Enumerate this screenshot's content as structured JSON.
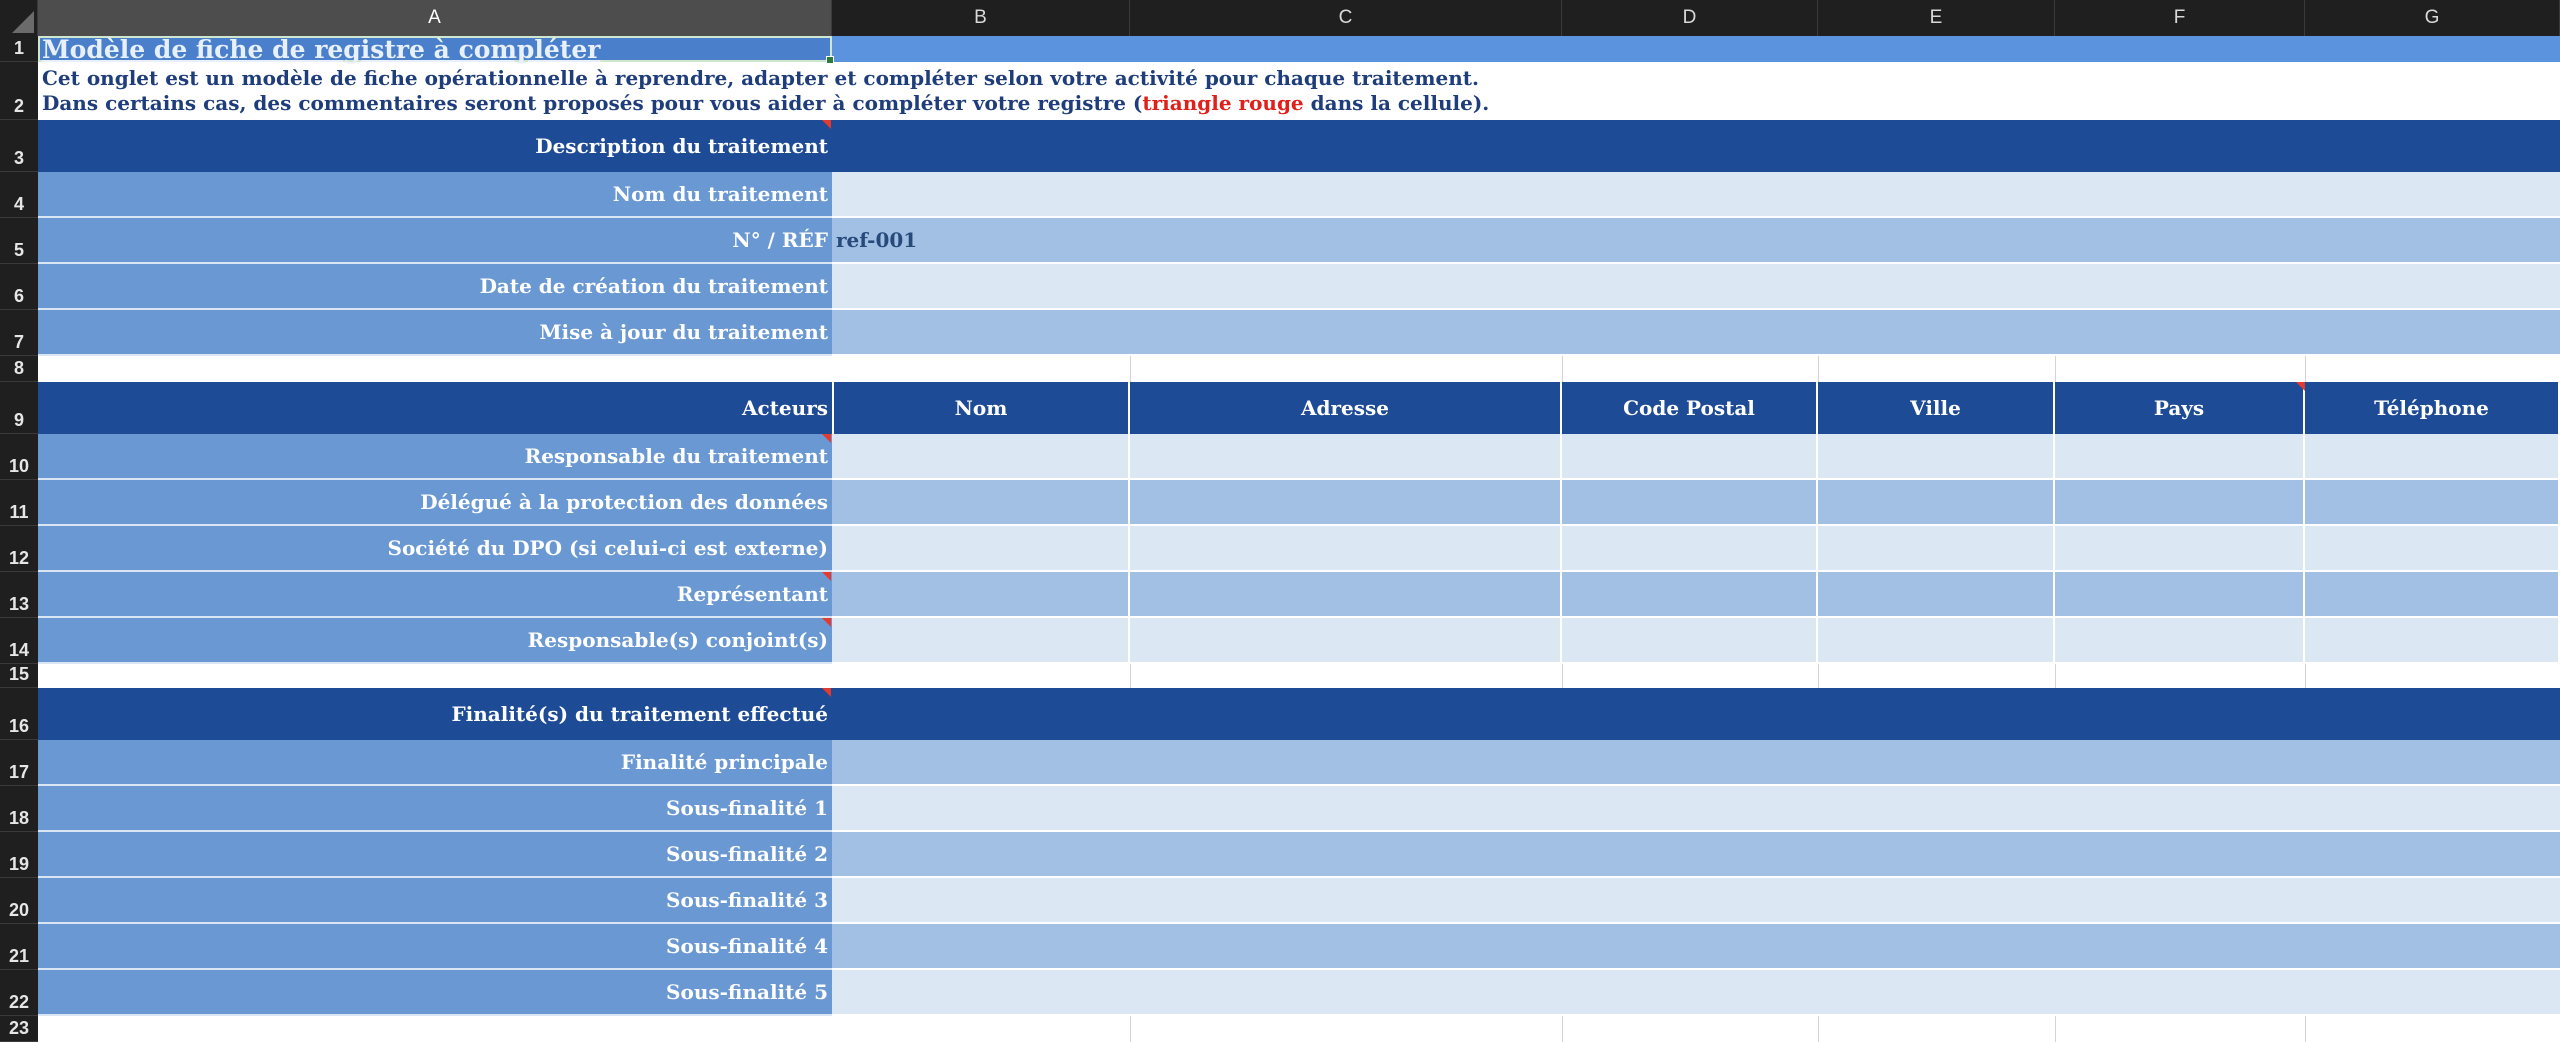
{
  "columns": [
    "A",
    "B",
    "C",
    "D",
    "E",
    "F",
    "G"
  ],
  "rows": [
    "1",
    "2",
    "3",
    "4",
    "5",
    "6",
    "7",
    "8",
    "9",
    "10",
    "11",
    "12",
    "13",
    "14",
    "15",
    "16",
    "17",
    "18",
    "19",
    "20",
    "21",
    "22",
    "23"
  ],
  "title": "Modèle de fiche de registre à compléter",
  "instructions": {
    "line1": "Cet onglet est un modèle de fiche opérationnelle à reprendre, adapter et compléter selon votre activité pour chaque traitement.",
    "line2_before": "Dans certains cas, des commentaires seront proposés pour vous aider à compléter votre registre (",
    "line2_red": "triangle rouge",
    "line2_after": " dans la cellule)."
  },
  "description": {
    "header": "Description  du traitement",
    "fields": [
      {
        "label": "Nom du traitement",
        "value": ""
      },
      {
        "label": "N° / RÉF",
        "value": "ref-001"
      },
      {
        "label": "Date de création du traitement",
        "value": ""
      },
      {
        "label": "Mise à jour du traitement",
        "value": ""
      }
    ]
  },
  "actors": {
    "header": "Acteurs",
    "columns": [
      "Nom",
      "Adresse",
      "Code Postal",
      "Ville",
      "Pays",
      "Téléphone"
    ],
    "rows": [
      "Responsable du traitement",
      "Délégué à la protection des données",
      "Société du DPO (si celui-ci est externe)",
      "Représentant",
      "Responsable(s) conjoint(s)"
    ]
  },
  "finalites": {
    "header": "Finalité(s) du traitement effectué",
    "rows": [
      "Finalité principale",
      "Sous-finalité 1",
      "Sous-finalité 2",
      "Sous-finalité 3",
      "Sous-finalité 4",
      "Sous-finalité 5"
    ]
  },
  "colors": {
    "section": "#1e4b96",
    "label": "#6a98d2",
    "light": "#dce7f4",
    "mid": "#a2c0e4",
    "comment": "#e53a2f"
  }
}
